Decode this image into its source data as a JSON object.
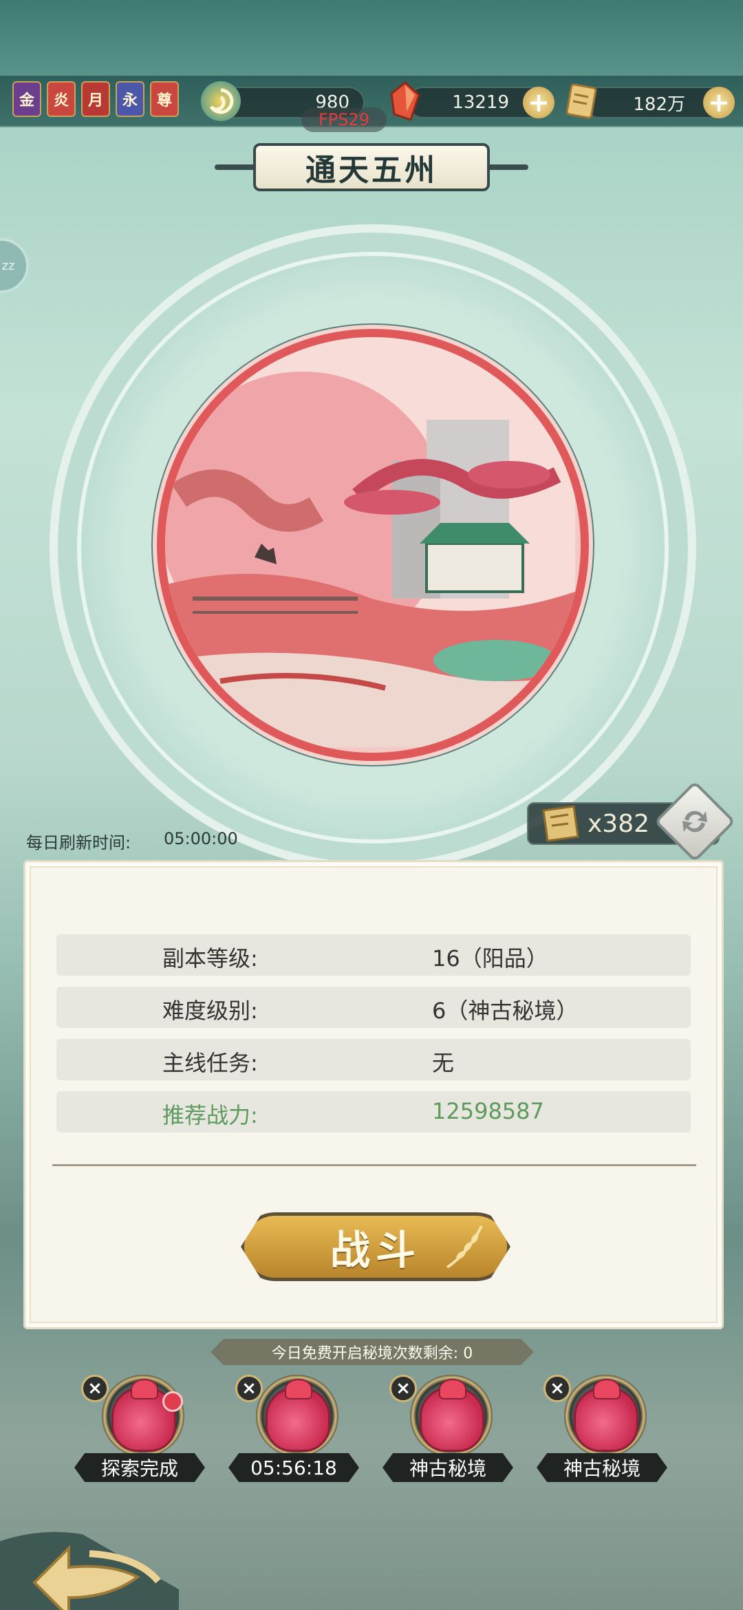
{
  "header": {
    "badges": [
      "金",
      "炎",
      "月",
      "永",
      "尊"
    ],
    "resources": [
      {
        "icon": "swirl-orb-icon",
        "value": "980"
      },
      {
        "icon": "red-crystal-icon",
        "value": "13219"
      },
      {
        "icon": "scroll-coin-icon",
        "value": "182万"
      }
    ],
    "fps": "FPS29"
  },
  "title": "通天五州",
  "side_tab": "zz",
  "refresh": {
    "label": "每日刷新时间:",
    "time": "05:00:00"
  },
  "ticket_count": "x382",
  "info": {
    "rows": [
      {
        "label": "副本等级:",
        "value": "16（阳品）"
      },
      {
        "label": "难度级别:",
        "value": "6（神古秘境）"
      },
      {
        "label": "主线任务:",
        "value": "无"
      },
      {
        "label": "推荐战力:",
        "value": "12598587"
      }
    ],
    "highlight_color": "#5e9a5e"
  },
  "fight_button": "战斗",
  "free_opens": "今日免费开启秘境次数剩余: 0",
  "bags": [
    {
      "label": "探索完成",
      "has_dot": true
    },
    {
      "label": "05:56:18",
      "has_dot": false
    },
    {
      "label": "神古秘境",
      "has_dot": false
    },
    {
      "label": "神古秘境",
      "has_dot": false
    }
  ]
}
